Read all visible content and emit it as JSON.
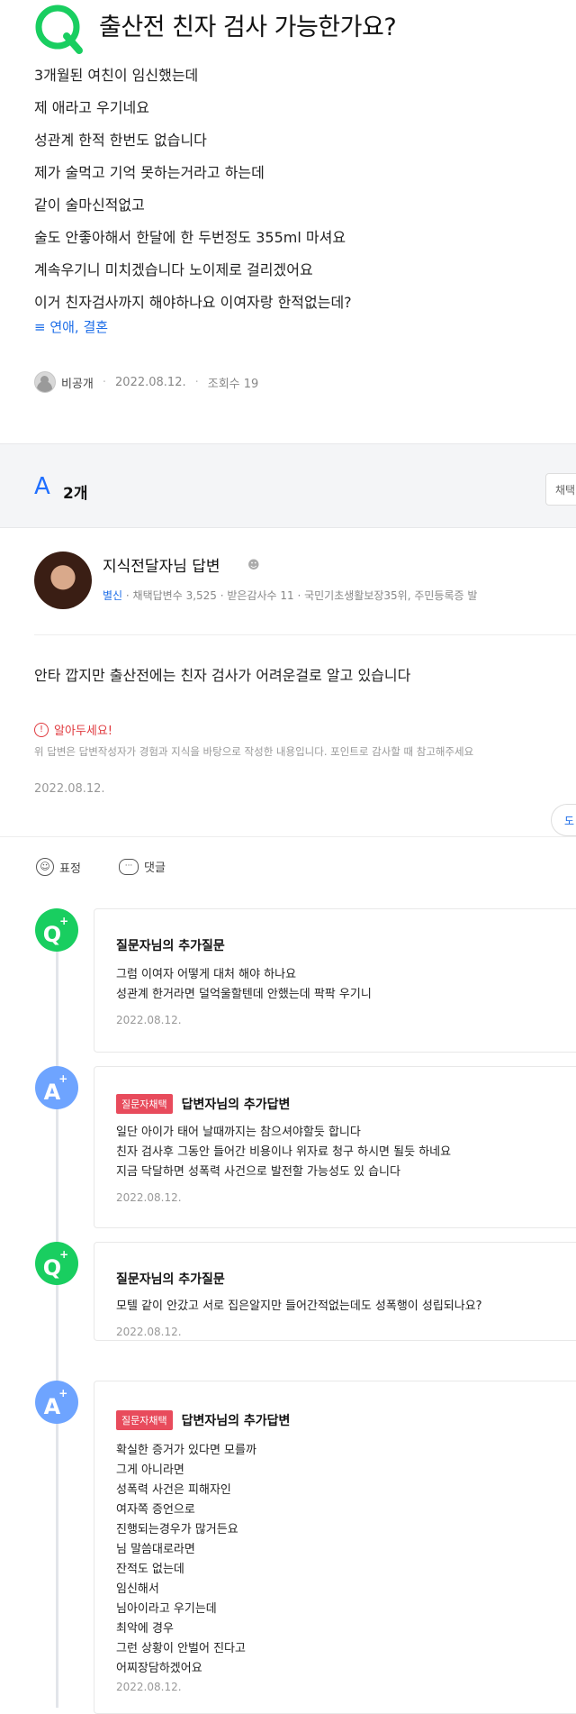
{
  "question": {
    "logo_letter": "Q",
    "title": "출산전 친자 검사 가능한가요?",
    "body_lines": [
      "3개월된 여친이 임신했는데",
      "제 애라고 우기네요",
      "성관계 한적 한번도 없습니다",
      "제가 술먹고 기억 못하는거라고 하는데",
      "같이 술마신적없고",
      "술도 안좋아해서 한달에 한 두번정도 355ml 마셔요",
      "계속우기니 미치겠습니다 노이제로 걸리겠어요",
      "이거 친자검사까지 해야하나요 이여자랑 한적없는데?"
    ],
    "category": "≡ 연애, 결혼",
    "author": "비공개",
    "date": "2022.08.12.",
    "views": "조회수 19"
  },
  "answers_header": {
    "letter": "A",
    "count": "2개",
    "sort_label": "채택"
  },
  "answer": {
    "name": "지식전달자님 답변",
    "grade": "별신",
    "stats": "· 채택답변수 3,525 · 받은감사수 11 · 국민기초생활보장35위, 주민등록증 발",
    "text": "안타 깝지만 출산전에는 친자 검사가 어려운걸로 알고 있습니다",
    "notice_title": "알아두세요!",
    "notice_text": "위 답변은 답변작성자가 경험과 지식을 바탕으로 작성한 내용입니다. 포인트로 감사할 때 참고해주세요",
    "date": "2022.08.12.",
    "more_label": "도",
    "emoji_label": "표정",
    "comment_label": "댓글"
  },
  "thread": [
    {
      "type": "q",
      "node": "Q",
      "header": "질문자님의 추가질문",
      "tag": "",
      "lines": [
        "그럼 이여자 어떻게 대처 해야 하나요",
        "성관계 한거라면 덜억울할텐데 안했는데 팍팍 우기니"
      ],
      "date": "2022.08.12."
    },
    {
      "type": "a",
      "node": "A",
      "header": "답변자님의 추가답변",
      "tag": "질문자채택",
      "lines": [
        "일단 아이가 태어 날때까지는 참으셔야할듯 합니다",
        "친자 검사후 그동안 들어간 비용이나 위자료 청구 하시면 될듯 하네요",
        "지금 닥달하면 성폭력 사건으로 발전할 가능성도 있 습니다"
      ],
      "date": "2022.08.12."
    },
    {
      "type": "q",
      "node": "Q",
      "header": "질문자님의 추가질문",
      "tag": "",
      "lines": [
        "모텔 같이 안갔고 서로 집은알지만 들어간적없는데도 성폭행이 성립되나요?"
      ],
      "date": "2022.08.12."
    },
    {
      "type": "a",
      "node": "A",
      "header": "답변자님의 추가답변",
      "tag": "질문자채택",
      "lines": [
        "확실한 증거가 있다면 모를까",
        "그게 아니라면",
        "성폭력 사건은 피해자인",
        "여자쪽 증언으로",
        "진행되는경우가 많거든요",
        "님 말씀대로라면",
        "잔적도 없는데",
        "임신해서",
        "님아이라고 우기는데",
        "최악에 경우",
        "그런 상황이 안벌어 진다고",
        "어찌장담하겠어요"
      ],
      "date": "2022.08.12."
    }
  ],
  "colors": {
    "naver_green": "#19ce60",
    "answer_blue": "#6ea4ff",
    "accent_blue": "#1e6ee8",
    "tag_red": "#e84b5c",
    "notice_red": "#e0393e"
  }
}
